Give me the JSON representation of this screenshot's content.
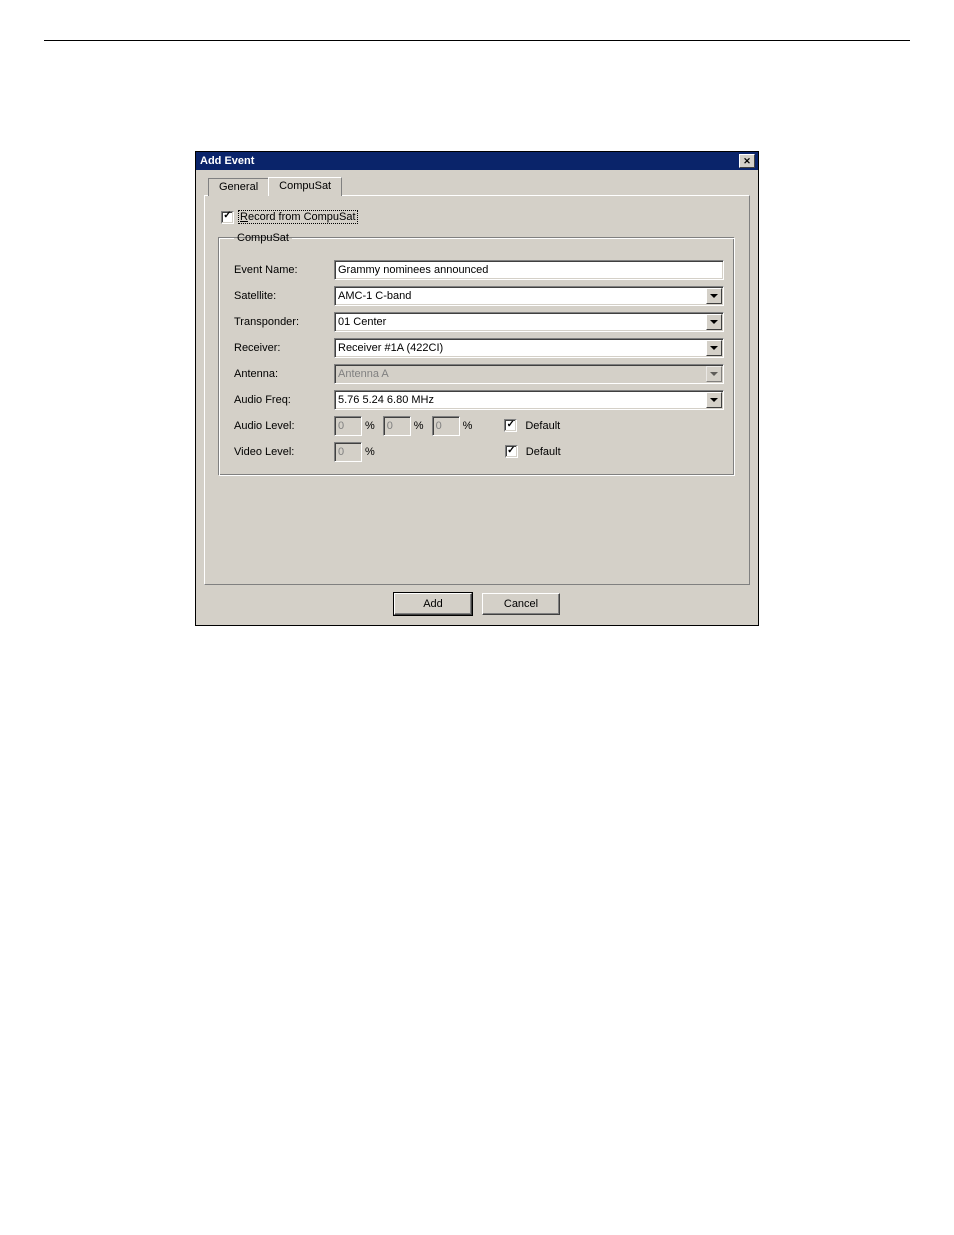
{
  "dialog": {
    "title": "Add Event",
    "close_glyph": "✕"
  },
  "tabs": {
    "general": "General",
    "compusat": "CompuSat"
  },
  "record_check": {
    "prefix": "R",
    "rest": "ecord from CompuSat"
  },
  "groupbox_title": "CompuSat",
  "labels": {
    "event_name": "Event Name:",
    "satellite": "Satellite:",
    "transponder": "Transponder:",
    "receiver": "Receiver:",
    "antenna": "Antenna:",
    "audio_freq": "Audio Freq:",
    "audio_level": "Audio Level:",
    "video_level": "Video Level:",
    "default": "Default",
    "pct": "%"
  },
  "values": {
    "event_name": "Grammy nominees announced",
    "satellite": "AMC-1  C-band",
    "transponder": "01 Center",
    "receiver": "Receiver #1A (422CI)",
    "antenna": "Antenna A",
    "audio_freq": "5.76 5.24 6.80 MHz",
    "audio_level_1": "0",
    "audio_level_2": "0",
    "audio_level_3": "0",
    "video_level": "0",
    "audio_default_checked": true,
    "video_default_checked": true
  },
  "buttons": {
    "add": "Add",
    "cancel": "Cancel"
  }
}
